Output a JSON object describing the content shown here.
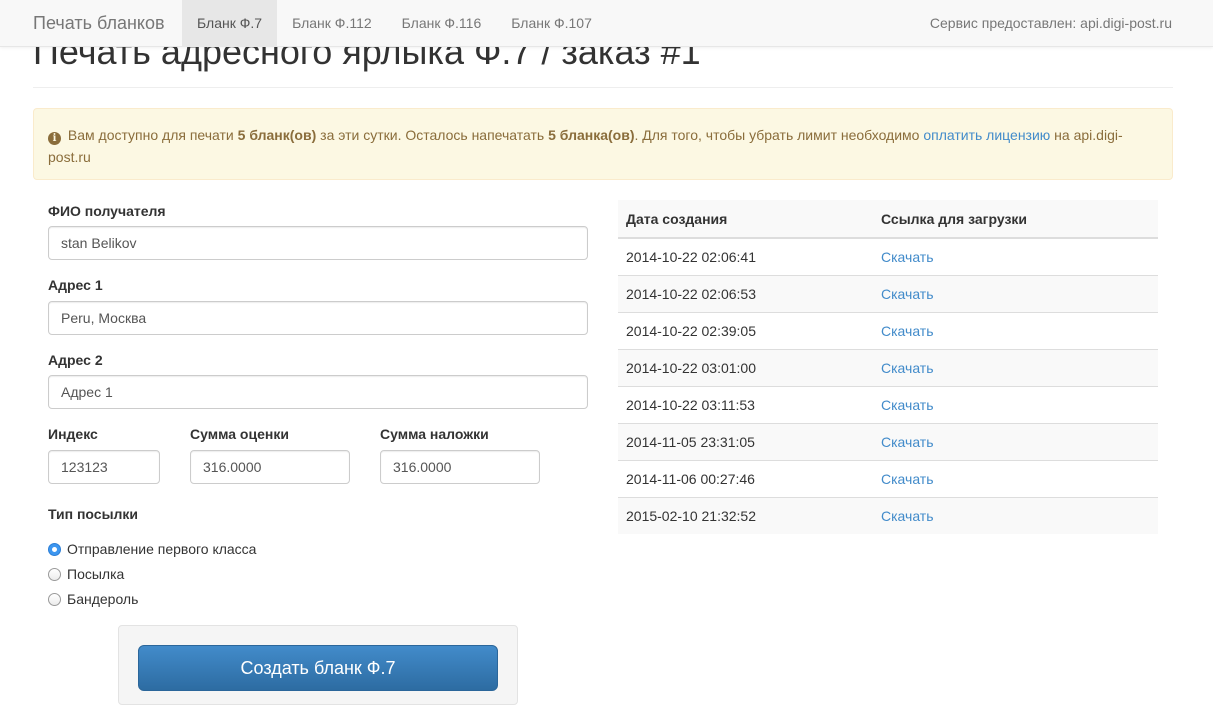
{
  "navbar": {
    "brand": "Печать бланков",
    "tabs": [
      "Бланк Ф.7",
      "Бланк Ф.112",
      "Бланк Ф.116",
      "Бланк Ф.107"
    ],
    "active_tab": "Бланк Ф.7",
    "service_text": "Сервис предоставлен: api.digi-post.ru"
  },
  "page": {
    "title": "Печать адресного ярлыка Ф.7 / заказ #1"
  },
  "alert": {
    "text1": " Вам доступно для печати ",
    "limit": "5 бланк(ов)",
    "text2": " за эти сутки. Осталось напечатать ",
    "remaining": "5 бланка(ов)",
    "text3": ". Для того, чтобы убрать лимит необходимо ",
    "link": "оплатить лицензию",
    "text4": " на api.digi-post.ru"
  },
  "form": {
    "recipient_label": "ФИО получателя",
    "recipient_value": "stan Belikov",
    "address1_label": "Адрес 1",
    "address1_value": "Peru, Москва",
    "address2_label": "Адрес 2",
    "address2_value": "Адрес 1",
    "index_label": "Индекс",
    "index_value": "123123",
    "valuation_label": "Сумма оценки",
    "valuation_value": "316.0000",
    "cod_label": "Сумма наложки",
    "cod_value": "316.0000",
    "parcel_type_label": "Тип посылки",
    "parcel_types": [
      "Отправление первого класса",
      "Посылка",
      "Бандероль"
    ],
    "selected_parcel_type": "Отправление первого класса",
    "submit_label": "Создать бланк Ф.7"
  },
  "history": {
    "col_date": "Дата создания",
    "col_link": "Ссылка для загрузки",
    "rows": [
      {
        "date": "2014-10-22 02:06:41",
        "link": "Скачать"
      },
      {
        "date": "2014-10-22 02:06:53",
        "link": "Скачать"
      },
      {
        "date": "2014-10-22 02:39:05",
        "link": "Скачать"
      },
      {
        "date": "2014-10-22 03:01:00",
        "link": "Скачать"
      },
      {
        "date": "2014-10-22 03:11:53",
        "link": "Скачать"
      },
      {
        "date": "2014-11-05 23:31:05",
        "link": "Скачать"
      },
      {
        "date": "2014-11-06 00:27:46",
        "link": "Скачать"
      },
      {
        "date": "2015-02-10 21:32:52",
        "link": "Скачать"
      }
    ]
  },
  "icons": {
    "alert_icon": "info-circle-icon"
  }
}
